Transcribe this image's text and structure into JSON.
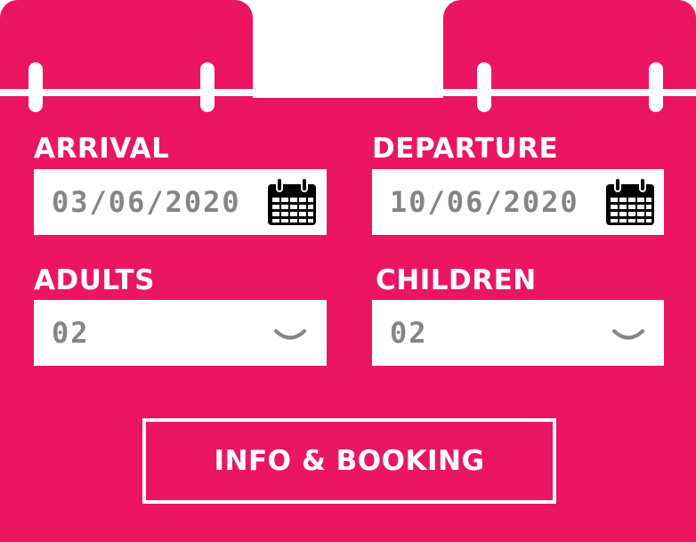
{
  "colors": {
    "accent": "#ec1562",
    "field_bg": "#ffffff",
    "value_text": "#858585"
  },
  "booking": {
    "arrival": {
      "label": "ARRIVAL",
      "value": "03/06/2020",
      "icon": "calendar-icon"
    },
    "departure": {
      "label": "DEPARTURE",
      "value": "10/06/2020",
      "icon": "calendar-icon"
    },
    "adults": {
      "label": "ADULTS",
      "value": "02",
      "icon": "chevron-down-icon"
    },
    "children": {
      "label": "CHILDREN",
      "value": "02",
      "icon": "chevron-down-icon"
    },
    "submit_label": "INFO & BOOKING"
  }
}
